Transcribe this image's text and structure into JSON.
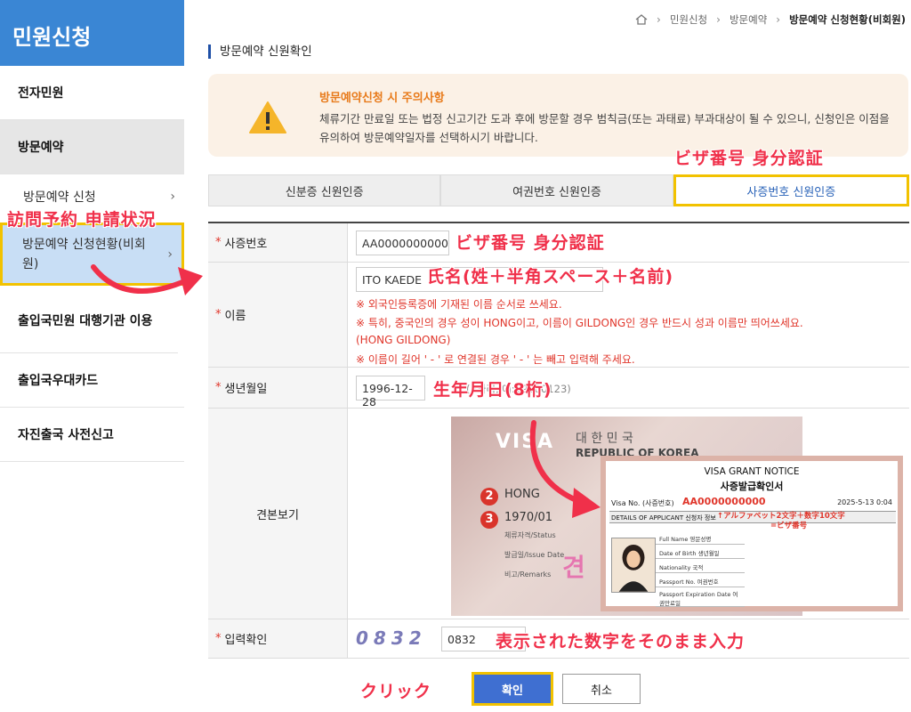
{
  "sidebar": {
    "title": "민원신청",
    "items": [
      {
        "label": "전자민원"
      },
      {
        "label": "방문예약"
      },
      {
        "label": "출입국민원 대행기관 이용"
      },
      {
        "label": "출입국우대카드"
      },
      {
        "label": "자진출국 사전신고"
      }
    ],
    "subitems": [
      {
        "label": "방문예약 신청"
      },
      {
        "label": "방문예약 신청현황(비회원)"
      }
    ]
  },
  "breadcrumb": {
    "items": [
      "민원신청",
      "방문예약",
      "방문예약 신청현황(비회원)"
    ]
  },
  "page_title": "방문예약 신원확인",
  "notice": {
    "title": "방문예약신청 시 주의사항",
    "body": "체류기간 만료일 또는 법정 신고기간 도과 후에 방문할 경우 범칙금(또는 과태료) 부과대상이 될 수 있으니, 신청인은 이점을 유의하여 방문예약일자를 선택하시기 바랍니다."
  },
  "tabs": [
    {
      "label": "신분증 신원인증"
    },
    {
      "label": "여권번호 신원인증"
    },
    {
      "label": "사증번호 신원인증"
    }
  ],
  "form": {
    "visa_no_label": "사증번호",
    "visa_no_value": "AA0000000000",
    "name_label": "이름",
    "name_value": "ITO KAEDE",
    "name_notes": [
      "※ 외국인등록증에 기재된 이름 순서로 쓰세요.",
      "※ 특히, 중국인의 경우 성이 HONG이고, 이름이 GILDONG인 경우 반드시 성과 이름만 띄어쓰세요.",
      "(HONG GILDONG)",
      "※ 이름이 길어 ' - ' 로 연결된 경우 ' - ' 는 빼고 입력해 주세요."
    ],
    "dob_label": "생년월일",
    "dob_value": "1996-12-28",
    "dob_hint": "(8자리, 예:19000123)",
    "sample_label": "견본보기",
    "captcha_label": "입력확인",
    "captcha_image_text": "0832",
    "captcha_value": "0832"
  },
  "sample_image": {
    "visa_word": "VISA",
    "korea": "대 한 민 국",
    "rok": "REPUBLIC OF KOREA",
    "num2": "2",
    "num3": "3",
    "hong": "HONG",
    "dob": "1970/01",
    "small1": "체류자격/Status",
    "small2": "발급일/Issue Date",
    "small3": "비고/Remarks",
    "stamp": "견"
  },
  "grant_notice": {
    "title_en": "VISA GRANT NOTICE",
    "title_kr": "사증발급확인서",
    "visa_no_label": "Visa No. (사증번호)",
    "visa_no_value": "AA0000000000",
    "date": "2025-5-13 0:04",
    "details": "DETAILS OF APPLICANT 신청자 정보",
    "red1": "↑アルファベット2文字＋数字10文字",
    "red2": "=ビザ番号",
    "rows": [
      "Full Name 영문성명",
      "Date of Birth 생년월일",
      "Nationality 국적",
      "Passport No. 여권번호",
      "Passport Expiration Date 여권만료일"
    ]
  },
  "buttons": {
    "confirm": "확인",
    "cancel": "취소"
  },
  "annotations": {
    "visa_tab": "ビザ番号 身分認証",
    "visit_status": "訪問予約 申請状況",
    "visa_field": "ビザ番号 身分認証",
    "name_field": "氏名(姓＋半角スペース＋名前)",
    "dob_field": "生年月日(8桁)",
    "captcha_field": "表示された数字をそのまま入力",
    "click": "クリック"
  },
  "colors": {
    "accent": "#3a86d4",
    "highlight": "#f2c200",
    "annotation": "#f0304a",
    "primary_button": "#3f6fd1"
  }
}
